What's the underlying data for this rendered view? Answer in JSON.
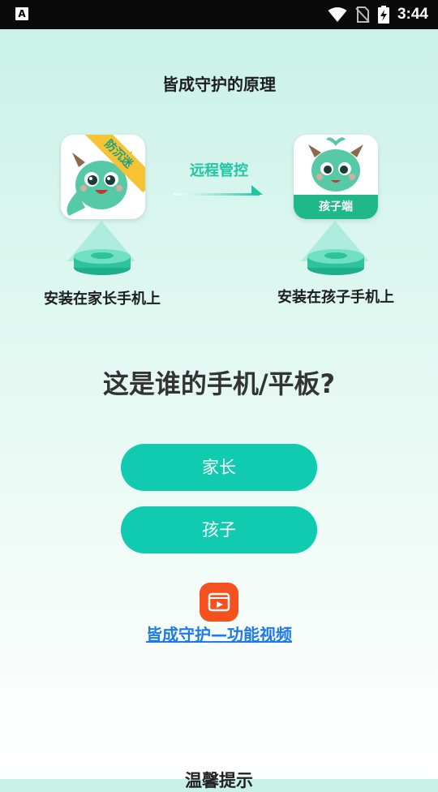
{
  "status_bar": {
    "time": "3:44",
    "left_icon": "A",
    "icons": [
      "wifi-icon",
      "no-sim-icon",
      "battery-charging-icon"
    ]
  },
  "header": {
    "title": "皆成守护的原理"
  },
  "diagram": {
    "parent_icon_ribbon": "防沉迷",
    "child_icon_band": "孩子端",
    "arrow_label": "远程管控",
    "parent_caption": "安装在家长手机上",
    "child_caption": "安装在孩子手机上"
  },
  "question": "这是谁的手机/平板?",
  "buttons": {
    "parent": "家长",
    "child": "孩子"
  },
  "video": {
    "link_text": "皆成守护—功能视频"
  },
  "tip_title": "温馨提示",
  "colors": {
    "accent": "#11cbb0",
    "link": "#1e7ae6",
    "video_icon": "#f4511e",
    "ribbon": "#f7c233",
    "mascot": "#56c9a6"
  }
}
